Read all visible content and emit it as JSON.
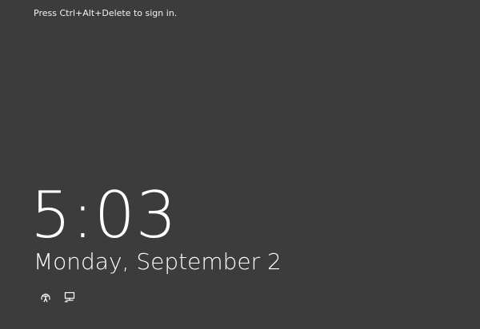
{
  "lock_screen": {
    "hint": "Press Ctrl+Alt+Delete to sign in.",
    "time": "5:03",
    "date": "Monday, September 2"
  },
  "tray": {
    "icons": [
      "ease-of-access-icon",
      "network-icon"
    ]
  },
  "colors": {
    "background": "#3c3c3c",
    "text": "#ffffff"
  }
}
